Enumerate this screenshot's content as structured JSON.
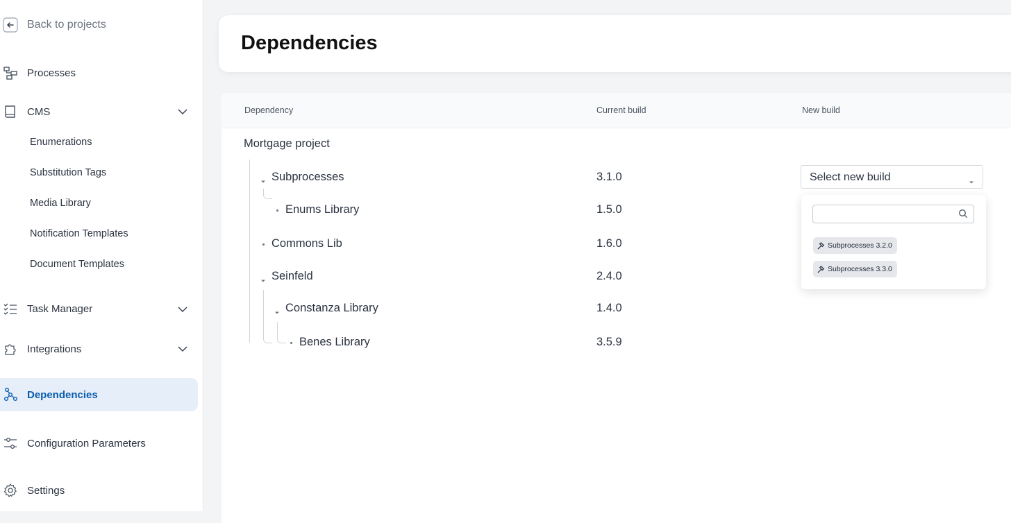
{
  "sidebar": {
    "back_label": "Back to projects",
    "items": [
      {
        "label": "Processes",
        "icon": "processes-icon"
      },
      {
        "label": "CMS",
        "icon": "book-icon"
      },
      {
        "label": "Task Manager",
        "icon": "checklist-icon"
      },
      {
        "label": "Integrations",
        "icon": "puzzle-icon"
      },
      {
        "label": "Dependencies",
        "icon": "dependencies-icon"
      },
      {
        "label": "Configuration Parameters",
        "icon": "sliders-icon"
      },
      {
        "label": "Settings",
        "icon": "gear-icon"
      }
    ],
    "cms_subitems": [
      "Enumerations",
      "Substitution Tags",
      "Media Library",
      "Notification Templates",
      "Document Templates"
    ],
    "active_color": "#0b5cad",
    "active_bg": "#e5eef9"
  },
  "page": {
    "title": "Dependencies"
  },
  "table": {
    "columns": [
      "Dependency",
      "Current build",
      "New build"
    ],
    "project": "Mortgage project",
    "rows": [
      {
        "name": "Subprocesses",
        "build": "3.1.0"
      },
      {
        "name": "Enums Library",
        "build": "1.5.0"
      },
      {
        "name": "Commons Lib",
        "build": "1.6.0"
      },
      {
        "name": "Seinfeld",
        "build": "2.4.0"
      },
      {
        "name": "Constanza Library",
        "build": "1.4.0"
      },
      {
        "name": "Benes Library",
        "build": "3.5.9"
      }
    ],
    "select_placeholder": "Select new build"
  },
  "dropdown": {
    "search_value": "",
    "options": [
      "Subprocesses 3.2.0",
      "Subprocesses 3.3.0"
    ]
  }
}
